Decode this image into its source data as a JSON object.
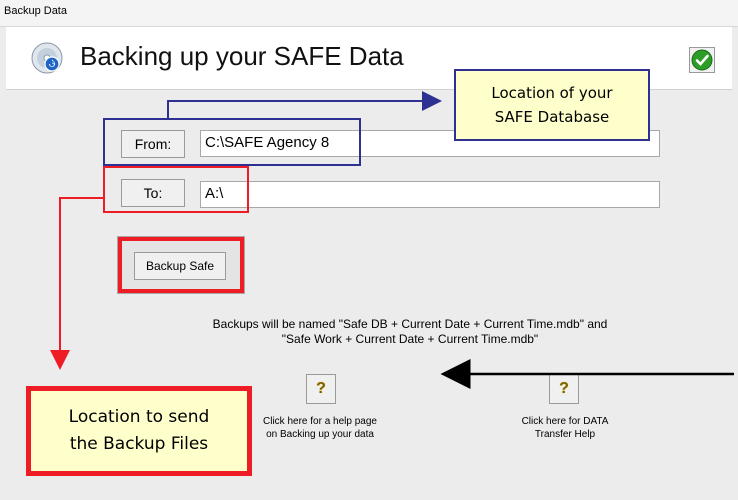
{
  "window": {
    "title": "Backup Data"
  },
  "header": {
    "title": "Backing up your SAFE Data"
  },
  "from": {
    "label": "From:",
    "value": "C:\\SAFE Agency 8"
  },
  "to": {
    "label": "To:",
    "value": "A:\\"
  },
  "backup": {
    "label": "Backup Safe"
  },
  "naming_note": {
    "line1": "Backups will be named \"Safe DB + Current Date + Current Time.mdb\" and",
    "line2": "\"Safe Work + Current Date + Current Time.mdb\""
  },
  "help": {
    "left_line1": "Click here for a help page",
    "left_line2": "on Backing up your data",
    "right_line1": "Click here for DATA",
    "right_line2": "Transfer Help"
  },
  "callouts": {
    "location_db_line1": "Location of your",
    "location_db_line2": "SAFE Database",
    "location_send_line1": "Location to send",
    "location_send_line2": "the Backup Files"
  },
  "colors": {
    "callout_bg": "#ffffcc",
    "navy": "#2e3192",
    "red": "#ee1c24"
  }
}
